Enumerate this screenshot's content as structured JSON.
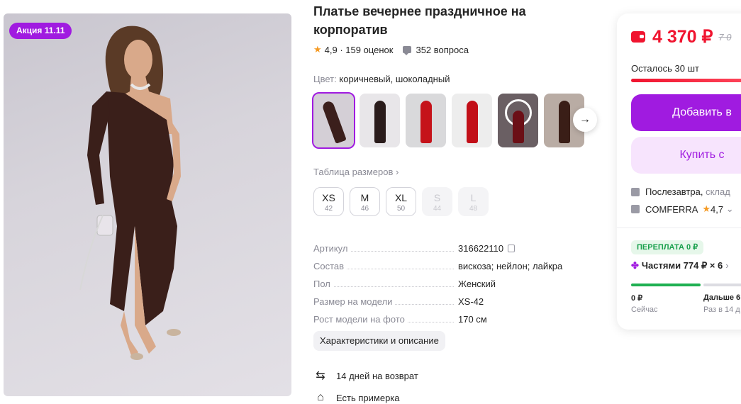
{
  "promo_badge": "Акция 11.11",
  "product": {
    "title": "Платье вечернее праздничное на корпоратив",
    "rating": "4,9",
    "reviews": "159 оценок",
    "questions": "352 вопроса",
    "color_label": "Цвет:",
    "color_value": "коричневый, шоколадный"
  },
  "size_table_link": "Таблица размеров",
  "sizes": [
    {
      "label": "XS",
      "ru": "42",
      "available": true
    },
    {
      "label": "M",
      "ru": "46",
      "available": true
    },
    {
      "label": "XL",
      "ru": "50",
      "available": true
    },
    {
      "label": "S",
      "ru": "44",
      "available": false
    },
    {
      "label": "L",
      "ru": "48",
      "available": false
    }
  ],
  "specs": [
    {
      "key": "Артикул",
      "value": "316622110"
    },
    {
      "key": "Состав",
      "value": "вискоза; нейлон; лайкра"
    },
    {
      "key": "Пол",
      "value": "Женский"
    },
    {
      "key": "Размер на модели",
      "value": "XS-42"
    },
    {
      "key": "Рост модели на фото",
      "value": "170 см"
    }
  ],
  "characteristics_button": "Характеристики и описание",
  "features": [
    {
      "icon": "return-arrows-icon",
      "text": "14 дней на возврат"
    },
    {
      "icon": "hanger-icon",
      "text": "Есть примерка"
    }
  ],
  "buy_card": {
    "price": "4 370 ₽",
    "old_price": "7 0",
    "stock": "Осталось 30 шт",
    "stock_fraction": 1.0,
    "add_button": "Добавить в",
    "buy_button": "Купить с",
    "delivery": "Послезавтра,",
    "delivery_muted": "склад",
    "seller": "COMFERRA",
    "seller_rating": "4,7",
    "overpay_badge": "ПЕРЕПЛАТА 0 ₽",
    "installments": "Частями 774 ₽ × 6",
    "pay_now_amount": "0 ₽",
    "pay_now_label": "Сейчас",
    "pay_later_amount": "Дальше 6",
    "pay_later_label": "Раз в 14 д"
  },
  "colors": {
    "accent": "#a01be0",
    "price_red": "#f0142f",
    "green": "#1fb052"
  }
}
